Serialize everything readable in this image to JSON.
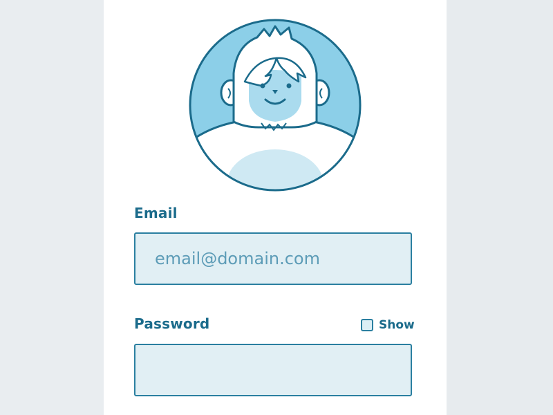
{
  "form": {
    "email": {
      "label": "Email",
      "placeholder": "email@domain.com",
      "value": ""
    },
    "password": {
      "label": "Password",
      "value": "",
      "show_label": "Show",
      "show_checked": false
    }
  },
  "avatar": {
    "icon": "yeti-mascot-icon"
  },
  "colors": {
    "accent": "#1b6b8b",
    "border": "#2a7fa0",
    "avatar_bg": "#8ccfe8",
    "input_bg": "#e1eff4",
    "page_bg": "#e9edf0",
    "card_bg": "#ffffff"
  }
}
